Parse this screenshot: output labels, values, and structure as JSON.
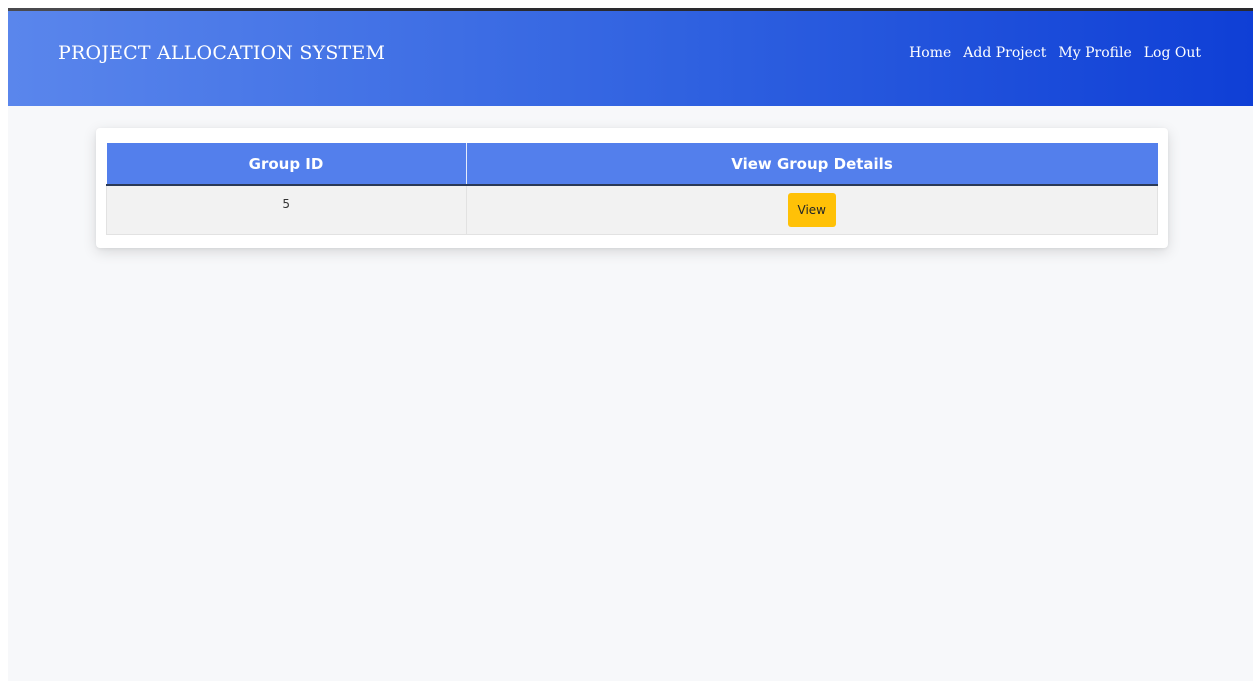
{
  "navbar": {
    "brand": "PROJECT ALLOCATION SYSTEM",
    "links": [
      {
        "label": "Home"
      },
      {
        "label": "Add Project"
      },
      {
        "label": "My Profile"
      },
      {
        "label": "Log Out"
      }
    ],
    "gradient_start": "#5a86ec",
    "gradient_end": "#0f3fd6"
  },
  "table": {
    "headers": [
      "Group ID",
      "View Group Details"
    ],
    "header_color": "#537fec",
    "rows": [
      {
        "group_id": "5",
        "action_label": "View"
      }
    ],
    "action_button_color": "#ffc107"
  }
}
